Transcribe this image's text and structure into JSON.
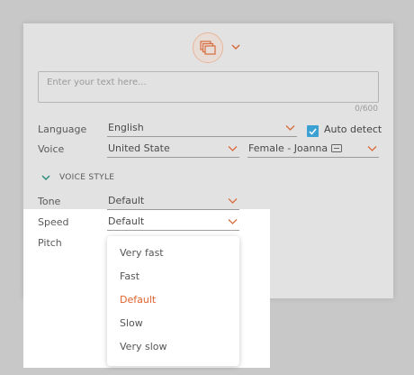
{
  "textarea": {
    "placeholder": "Enter your text here...",
    "counter": "0/600"
  },
  "language": {
    "label": "Language",
    "value": "English",
    "auto_detect_label": "Auto detect",
    "auto_detect_checked": true
  },
  "voice": {
    "label": "Voice",
    "region": "United State",
    "speaker": "Female - Joanna"
  },
  "voice_style": {
    "title": "VOICE STYLE"
  },
  "tone": {
    "label": "Tone",
    "value": "Default"
  },
  "speed": {
    "label": "Speed",
    "value": "Default",
    "options": [
      "Very fast",
      "Fast",
      "Default",
      "Slow",
      "Very slow"
    ],
    "selected": "Default"
  },
  "pitch": {
    "label": "Pitch"
  },
  "colors": {
    "accent": "#e0622e",
    "checkbox": "#3aa1d2",
    "panel": "#e2e2e2",
    "backdrop": "#c8c8c8"
  },
  "icons": [
    "documents-icon",
    "chevron-down-icon",
    "check-icon",
    "voice-sample-icon"
  ]
}
